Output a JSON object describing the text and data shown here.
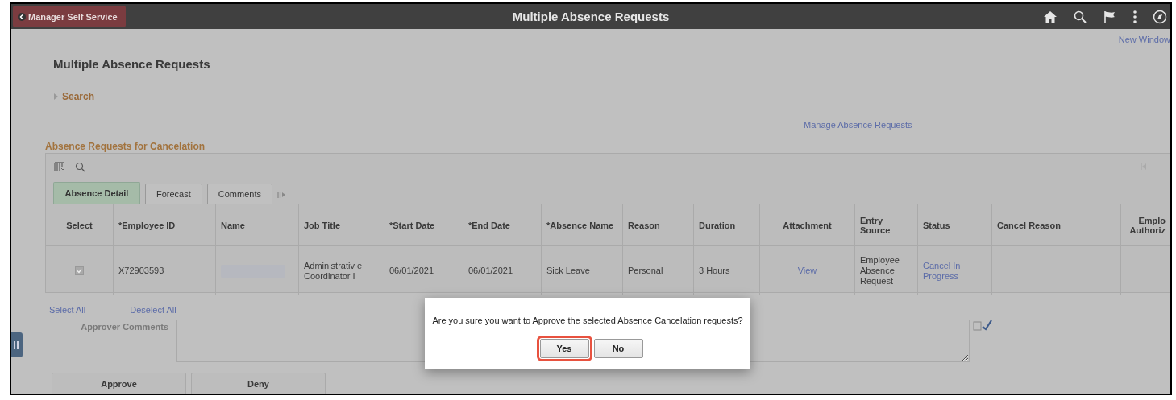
{
  "header": {
    "back_label": "Manager Self Service",
    "title": "Multiple Absence Requests"
  },
  "new_window": "New Window",
  "page_title": "Multiple Absence Requests",
  "search": {
    "label": "Search",
    "expanded": false
  },
  "manage_link": "Manage Absence Requests",
  "grid": {
    "title": "Absence Requests for Cancelation",
    "tabs": [
      {
        "label": "Absence Detail",
        "selected": true
      },
      {
        "label": "Forecast",
        "selected": false
      },
      {
        "label": "Comments",
        "selected": false
      }
    ],
    "columns": [
      "Select",
      "*Employee ID",
      "Name",
      "Job Title",
      "*Start Date",
      "*End Date",
      "*Absence Name",
      "Reason",
      "Duration",
      "Attachment",
      "Entry Source",
      "Status",
      "Cancel Reason",
      "Emplo Authoriz"
    ],
    "rows": [
      {
        "checked": true,
        "employee_id": "X72903593",
        "job_title": "Administrativ e Coordinator I",
        "start_date": "06/01/2021",
        "end_date": "06/01/2021",
        "absence_name": "Sick Leave",
        "reason": "Personal",
        "duration": "3 Hours",
        "attachment": "View",
        "entry_source": "Employee Absence Request",
        "status": "Cancel In Progress"
      }
    ]
  },
  "select_all": "Select All",
  "deselect_all": "Deselect All",
  "approver_comments_label": "Approver Comments",
  "buttons": [
    "Approve",
    "Deny"
  ],
  "dialog": {
    "message": "Are you sure you want to Approve the selected Absence Cancelation requests?",
    "buttons": [
      {
        "label": "Yes",
        "highlighted": true
      },
      {
        "label": "No",
        "highlighted": false
      }
    ]
  }
}
